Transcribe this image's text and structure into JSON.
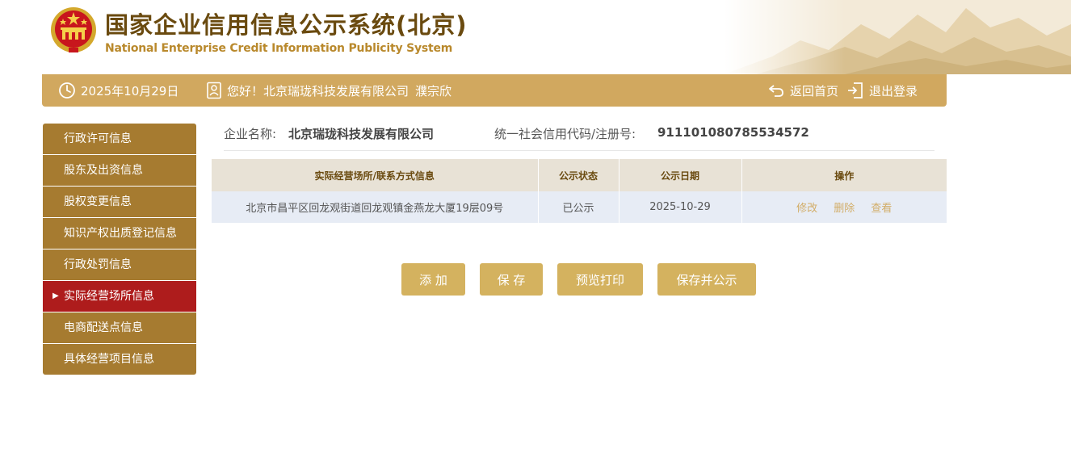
{
  "header": {
    "title_cn": "国家企业信用信息公示系统(北京)",
    "title_en": "National Enterprise Credit Information Publicity System"
  },
  "topbar": {
    "date": "2025年10月29日",
    "greeting": "您好！北京瑞珑科技发展有限公司",
    "username": "濮宗欣",
    "home_label": "返回首页",
    "logout_label": "退出登录"
  },
  "sidebar": {
    "items": [
      {
        "label": "行政许可信息"
      },
      {
        "label": "股东及出资信息"
      },
      {
        "label": "股权变更信息"
      },
      {
        "label": "知识产权出质登记信息"
      },
      {
        "label": "行政处罚信息"
      },
      {
        "label": "实际经营场所信息",
        "active": true
      },
      {
        "label": "电商配送点信息"
      },
      {
        "label": "具体经营项目信息"
      }
    ]
  },
  "company": {
    "name_label": "企业名称:",
    "name": "北京瑞珑科技发展有限公司",
    "code_label": "统一社会信用代码/注册号:",
    "code": "911101080785534572"
  },
  "table": {
    "headers": [
      "实际经营场所/联系方式信息",
      "公示状态",
      "公示日期",
      "操作"
    ],
    "rows": [
      {
        "address": "北京市昌平区回龙观街道回龙观镇金燕龙大厦19层09号",
        "status": "已公示",
        "date": "2025-10-29",
        "ops": [
          "修改",
          "删除",
          "查看"
        ]
      }
    ]
  },
  "buttons": {
    "add": "添 加",
    "save": "保 存",
    "preview": "预览打印",
    "save_publish": "保存并公示"
  },
  "icons": {
    "emblem": "national-emblem-icon",
    "date": "clock-icon",
    "user": "user-id-icon",
    "home": "return-icon",
    "logout": "logout-icon"
  },
  "colors": {
    "topbar": "#d1a85f",
    "sidebar": "#a67b30",
    "sidebar_active": "#ae1c1c",
    "button": "#d4b25f",
    "title": "#6a4a0f"
  }
}
